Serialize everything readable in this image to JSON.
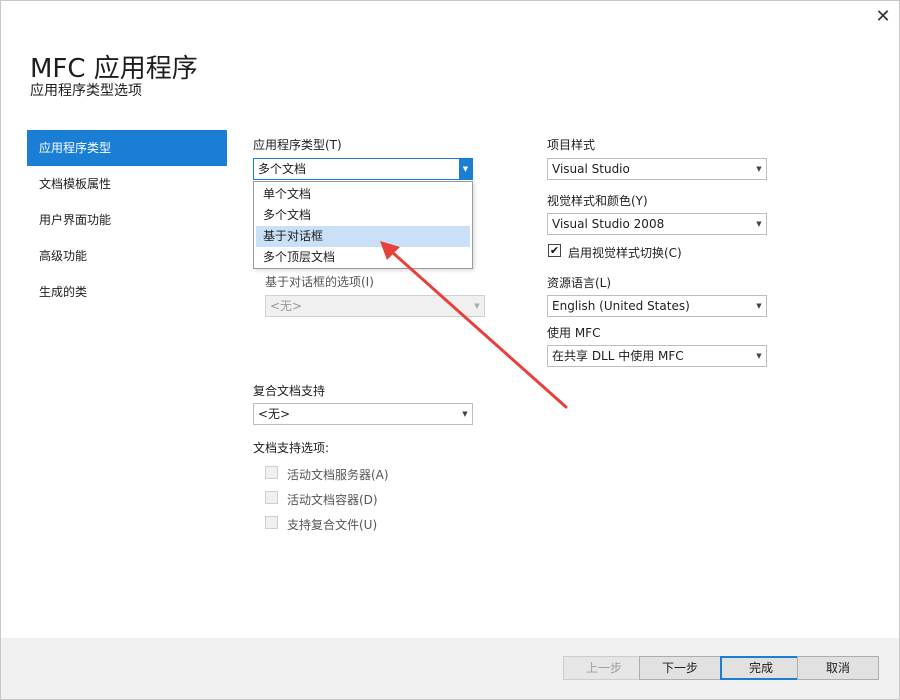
{
  "window": {
    "close_glyph": "✕",
    "title": "MFC 应用程序",
    "subtitle": "应用程序类型选项"
  },
  "sidebar": {
    "items": [
      {
        "label": "应用程序类型",
        "active": true
      },
      {
        "label": "文档模板属性",
        "active": false
      },
      {
        "label": "用户界面功能",
        "active": false
      },
      {
        "label": "高级功能",
        "active": false
      },
      {
        "label": "生成的类",
        "active": false
      }
    ]
  },
  "app_type": {
    "label": "应用程序类型(T)",
    "value": "多个文档",
    "options": [
      "单个文档",
      "多个文档",
      "基于对话框",
      "多个顶层文档"
    ],
    "highlighted": "基于对话框"
  },
  "dialog_options": {
    "label": "基于对话框的选项(I)",
    "value": "<无>"
  },
  "compound_doc": {
    "label": "复合文档支持",
    "value": "<无>"
  },
  "doc_support": {
    "label": "文档支持选项:",
    "options": [
      "活动文档服务器(A)",
      "活动文档容器(D)",
      "支持复合文件(U)"
    ]
  },
  "project_style": {
    "label": "项目样式",
    "value": "Visual Studio"
  },
  "visual_style": {
    "label": "视觉样式和颜色(Y)",
    "value": "Visual Studio 2008"
  },
  "enable_visual_switch": {
    "label": "启用视觉样式切换(C)",
    "checked": true
  },
  "resource_language": {
    "label": "资源语言(L)",
    "value": "English (United States)"
  },
  "use_mfc": {
    "label": "使用 MFC",
    "value": "在共享 DLL 中使用 MFC"
  },
  "footer": {
    "prev": "上一步",
    "next": "下一步",
    "finish": "完成",
    "cancel": "取消"
  },
  "annotation": {
    "arrow_color": "#e8403a"
  },
  "icons": {
    "dropdown": "chevron-down-icon",
    "check": "checkmark-icon",
    "close": "close-icon"
  }
}
